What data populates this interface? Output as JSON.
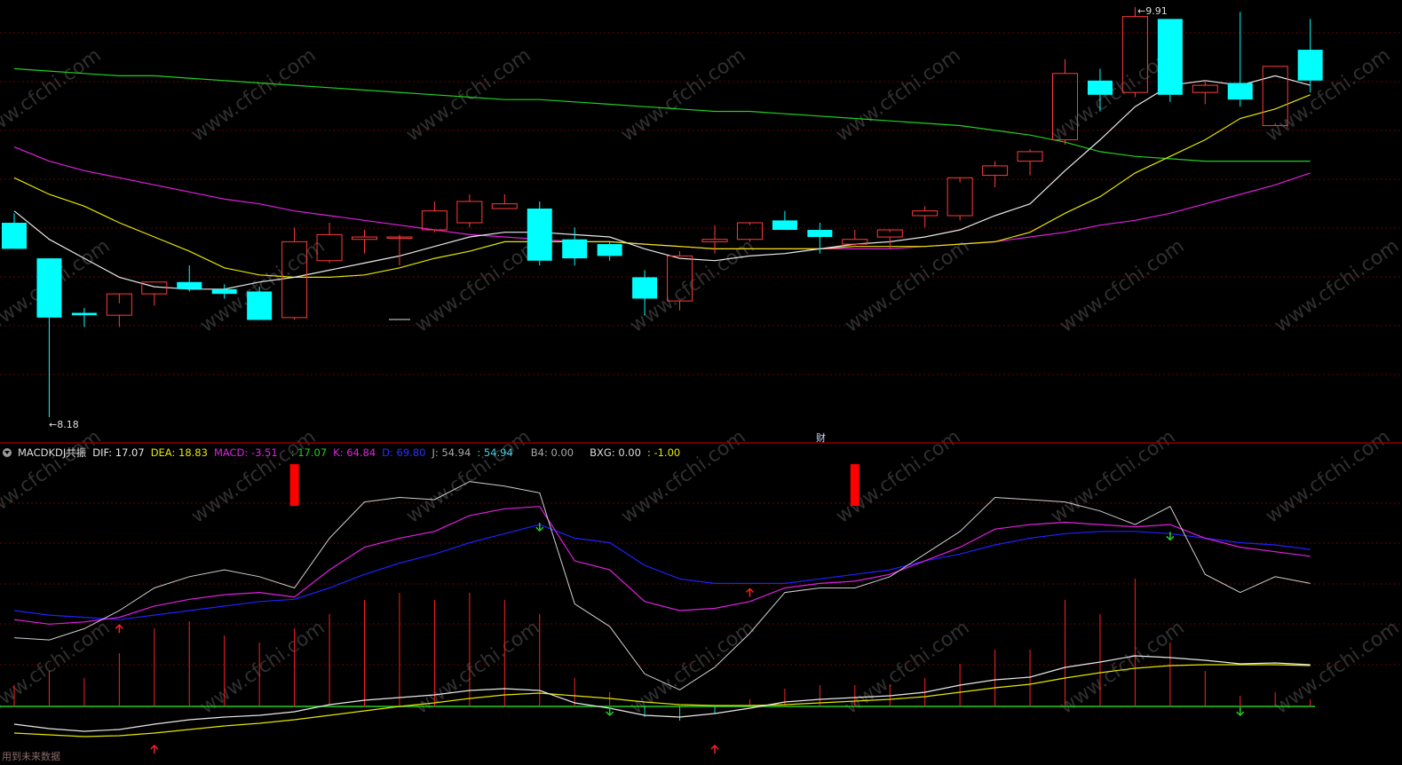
{
  "price_panel": {
    "max_label": "9.91",
    "min_label": "8.18",
    "finance_marker": "财"
  },
  "indicator": {
    "name": "MACDKDJ共振",
    "dif": "DIF: 17.07",
    "dea": "DEA: 18.83",
    "macd": "MACD: -3.51",
    "unnamed1": ": 17.07",
    "k": "K: 64.84",
    "d": "D: 69.80",
    "j": "J: 54.94",
    "unnamed2": ": 54.94",
    "b4": "B4: 0.00",
    "bxg": "BXG: 0.00",
    "unnamed3": ": -1.00"
  },
  "footer_text": "用到未来数据",
  "watermark": "www.cfchi.com",
  "colors": {
    "background": "#000000",
    "up_candle": "#ff3b3b",
    "down_candle": "#00ffff",
    "ma_white": "#e8e8e8",
    "ma_yellow": "#e6e600",
    "ma_magenta": "#e020e0",
    "ma_green": "#20d020",
    "k_line": "#e020e0",
    "d_line": "#2020ff",
    "j_line": "#d0d0d0",
    "j_down": "#40d0e0",
    "separator": "#8b0000",
    "grid": "#6a0000"
  },
  "chart_data": {
    "type": "candlestick",
    "candles": [
      {
        "o": 9.0,
        "h": 9.04,
        "l": 8.89,
        "c": 8.89
      },
      {
        "o": 8.85,
        "h": 8.85,
        "l": 8.18,
        "c": 8.6
      },
      {
        "o": 8.62,
        "h": 8.64,
        "l": 8.56,
        "c": 8.61
      },
      {
        "o": 8.61,
        "h": 8.66,
        "l": 8.56,
        "c": 8.7
      },
      {
        "o": 8.7,
        "h": 8.75,
        "l": 8.65,
        "c": 8.75
      },
      {
        "o": 8.75,
        "h": 8.82,
        "l": 8.71,
        "c": 8.72
      },
      {
        "o": 8.72,
        "h": 8.74,
        "l": 8.68,
        "c": 8.7
      },
      {
        "o": 8.71,
        "h": 8.73,
        "l": 8.59,
        "c": 8.59
      },
      {
        "o": 8.6,
        "h": 8.98,
        "l": 8.59,
        "c": 8.92
      },
      {
        "o": 8.84,
        "h": 9.0,
        "l": 8.83,
        "c": 8.95
      },
      {
        "o": 8.93,
        "h": 8.97,
        "l": 8.87,
        "c": 8.94
      },
      {
        "o": 8.94,
        "h": 8.95,
        "l": 8.82,
        "c": 8.94
      },
      {
        "o": 8.97,
        "h": 9.09,
        "l": 8.96,
        "c": 9.05
      },
      {
        "o": 9.0,
        "h": 9.12,
        "l": 8.98,
        "c": 9.09
      },
      {
        "o": 9.06,
        "h": 9.12,
        "l": 9.06,
        "c": 9.08
      },
      {
        "o": 9.06,
        "h": 9.09,
        "l": 8.82,
        "c": 8.84
      },
      {
        "o": 8.93,
        "h": 8.98,
        "l": 8.82,
        "c": 8.85
      },
      {
        "o": 8.91,
        "h": 8.92,
        "l": 8.84,
        "c": 8.86
      },
      {
        "o": 8.77,
        "h": 8.8,
        "l": 8.61,
        "c": 8.68
      },
      {
        "o": 8.67,
        "h": 8.88,
        "l": 8.63,
        "c": 8.86
      },
      {
        "o": 8.92,
        "h": 8.99,
        "l": 8.87,
        "c": 8.93
      },
      {
        "o": 8.93,
        "h": 8.99,
        "l": 8.92,
        "c": 9.0
      },
      {
        "o": 9.01,
        "h": 9.05,
        "l": 8.98,
        "c": 8.97
      },
      {
        "o": 8.97,
        "h": 9.0,
        "l": 8.87,
        "c": 8.94
      },
      {
        "o": 8.91,
        "h": 8.97,
        "l": 8.9,
        "c": 8.93
      },
      {
        "o": 8.94,
        "h": 8.96,
        "l": 8.89,
        "c": 8.97
      },
      {
        "o": 9.03,
        "h": 9.07,
        "l": 8.98,
        "c": 9.05
      },
      {
        "o": 9.03,
        "h": 9.17,
        "l": 9.01,
        "c": 9.19
      },
      {
        "o": 9.2,
        "h": 9.26,
        "l": 9.15,
        "c": 9.24
      },
      {
        "o": 9.26,
        "h": 9.31,
        "l": 9.2,
        "c": 9.3
      },
      {
        "o": 9.35,
        "h": 9.69,
        "l": 9.33,
        "c": 9.63
      },
      {
        "o": 9.6,
        "h": 9.65,
        "l": 9.47,
        "c": 9.54
      },
      {
        "o": 9.55,
        "h": 9.91,
        "l": 9.53,
        "c": 9.87
      },
      {
        "o": 9.86,
        "h": 9.86,
        "l": 9.51,
        "c": 9.54
      },
      {
        "o": 9.55,
        "h": 9.6,
        "l": 9.5,
        "c": 9.58
      },
      {
        "o": 9.59,
        "h": 9.89,
        "l": 9.49,
        "c": 9.52
      },
      {
        "o": 9.41,
        "h": 9.66,
        "l": 9.42,
        "c": 9.66
      },
      {
        "o": 9.73,
        "h": 9.86,
        "l": 9.55,
        "c": 9.6
      }
    ],
    "ma_white": [
      9.05,
      8.93,
      8.85,
      8.77,
      8.73,
      8.72,
      8.72,
      8.75,
      8.77,
      8.8,
      8.83,
      8.86,
      8.9,
      8.94,
      8.96,
      8.96,
      8.95,
      8.94,
      8.89,
      8.85,
      8.84,
      8.86,
      8.87,
      8.89,
      8.91,
      8.92,
      8.94,
      8.97,
      9.03,
      9.08,
      9.22,
      9.35,
      9.49,
      9.58,
      9.6,
      9.58,
      9.62,
      9.58
    ],
    "ma_yellow": [
      9.19,
      9.12,
      9.07,
      9.0,
      8.94,
      8.88,
      8.81,
      8.78,
      8.77,
      8.77,
      8.78,
      8.81,
      8.85,
      8.88,
      8.92,
      8.92,
      8.92,
      8.92,
      8.91,
      8.9,
      8.89,
      8.89,
      8.89,
      8.89,
      8.9,
      8.9,
      8.9,
      8.91,
      8.92,
      8.96,
      9.04,
      9.11,
      9.21,
      9.28,
      9.35,
      9.44,
      9.48,
      9.54
    ],
    "ma_magenta": [
      9.32,
      9.26,
      9.22,
      9.19,
      9.16,
      9.13,
      9.1,
      9.08,
      9.05,
      9.03,
      9.01,
      8.99,
      8.97,
      8.95,
      8.94,
      8.93,
      8.92,
      8.92,
      8.91,
      8.9,
      8.89,
      8.89,
      8.89,
      8.89,
      8.89,
      8.89,
      8.9,
      8.91,
      8.92,
      8.94,
      8.96,
      8.99,
      9.01,
      9.04,
      9.08,
      9.12,
      9.16,
      9.21
    ],
    "ma_green": [
      9.65,
      9.64,
      9.63,
      9.62,
      9.62,
      9.61,
      9.6,
      9.59,
      9.58,
      9.57,
      9.56,
      9.55,
      9.54,
      9.53,
      9.52,
      9.52,
      9.51,
      9.5,
      9.49,
      9.48,
      9.47,
      9.47,
      9.46,
      9.45,
      9.44,
      9.43,
      9.42,
      9.41,
      9.39,
      9.37,
      9.34,
      9.3,
      9.28,
      9.27,
      9.26,
      9.26,
      9.26,
      9.26
    ],
    "kdj_k": [
      36,
      34,
      35,
      37,
      42,
      45,
      47,
      48,
      46,
      58,
      68,
      72,
      75,
      82,
      85,
      86,
      62,
      58,
      44,
      40,
      41,
      44,
      50,
      52,
      53,
      56,
      62,
      68,
      76,
      78,
      79,
      78,
      77,
      78,
      72,
      68,
      66,
      64
    ],
    "kdj_d": [
      40,
      38,
      37,
      36,
      38,
      40,
      42,
      44,
      45,
      50,
      56,
      61,
      65,
      70,
      74,
      78,
      72,
      70,
      60,
      54,
      52,
      52,
      52,
      54,
      56,
      58,
      62,
      65,
      69,
      72,
      74,
      75,
      75,
      74,
      72,
      70,
      69,
      67
    ],
    "kdj_j": [
      28,
      27,
      32,
      40,
      50,
      55,
      58,
      55,
      50,
      72,
      88,
      90,
      89,
      97,
      95,
      92,
      43,
      33,
      12,
      5,
      15,
      30,
      48,
      50,
      50,
      55,
      65,
      75,
      90,
      89,
      88,
      84,
      78,
      86,
      56,
      48,
      55,
      52
    ],
    "macd_dif": [
      -2.0,
      -2.5,
      -2.8,
      -2.6,
      -2.0,
      -1.5,
      -1.2,
      -1.0,
      -0.6,
      0.2,
      0.7,
      1.0,
      1.3,
      1.8,
      2.0,
      1.8,
      0.4,
      -0.2,
      -1.0,
      -1.2,
      -0.8,
      -0.2,
      0.5,
      0.8,
      1.0,
      1.2,
      1.6,
      2.4,
      3.0,
      3.3,
      4.4,
      5.0,
      5.7,
      5.5,
      5.2,
      4.8,
      4.9,
      4.7
    ],
    "macd_dea": [
      -3.0,
      -3.2,
      -3.4,
      -3.3,
      -3.0,
      -2.6,
      -2.2,
      -1.9,
      -1.5,
      -1.0,
      -0.5,
      0.0,
      0.4,
      0.9,
      1.3,
      1.5,
      1.2,
      0.9,
      0.5,
      0.2,
      0.1,
      0.1,
      0.2,
      0.4,
      0.6,
      0.8,
      1.1,
      1.6,
      2.1,
      2.5,
      3.2,
      3.8,
      4.3,
      4.6,
      4.7,
      4.7,
      4.7,
      4.6
    ],
    "macd_hist": [
      0.6,
      1.0,
      0.8,
      1.5,
      2.2,
      2.4,
      2.0,
      1.8,
      2.2,
      2.6,
      3.0,
      3.2,
      3.0,
      3.2,
      3.0,
      2.6,
      0.8,
      0.4,
      -0.3,
      -0.4,
      -0.2,
      0.2,
      0.5,
      0.6,
      0.6,
      0.6,
      0.8,
      1.2,
      1.6,
      1.6,
      3.0,
      2.6,
      3.6,
      1.8,
      1.0,
      0.3,
      0.4,
      0.2
    ],
    "red_bar_signals": [
      8,
      24
    ],
    "up_arrows_kd": [
      3,
      21
    ],
    "down_arrows_kd": [
      15,
      33
    ],
    "up_arrows_macd": [
      4,
      20
    ],
    "down_arrows_macd": [
      17,
      35
    ]
  }
}
